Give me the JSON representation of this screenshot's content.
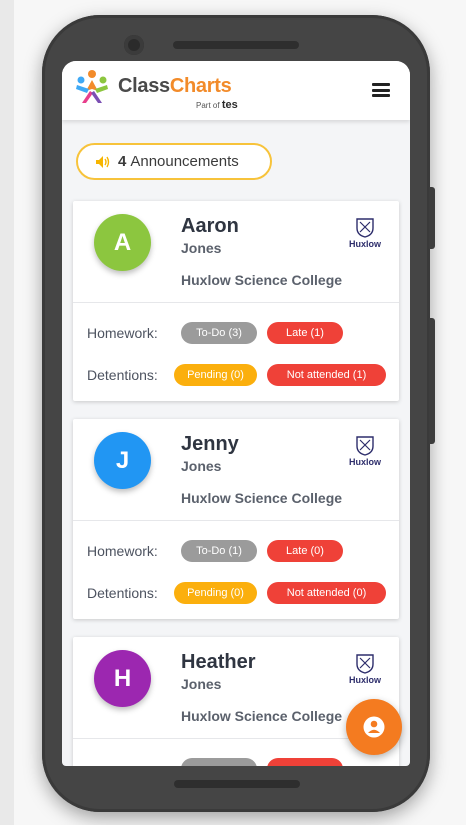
{
  "brand": {
    "name_part1": "Class",
    "name_part2": "Charts",
    "part_of": "Part of",
    "part_of_brand": "tes"
  },
  "announcements": {
    "count": "4",
    "label": "Announcements"
  },
  "labels": {
    "homework": "Homework:",
    "detentions": "Detentions:"
  },
  "students": [
    {
      "initial": "A",
      "first_name": "Aaron",
      "last_name": "Jones",
      "school": "Huxlow Science College",
      "school_logo_text": "Huxlow",
      "avatar_color": "#8cc63f",
      "homework": {
        "todo": "To-Do (3)",
        "late": "Late (1)"
      },
      "detentions": {
        "pending": "Pending (0)",
        "not_attended": "Not attended (1)"
      }
    },
    {
      "initial": "J",
      "first_name": "Jenny",
      "last_name": "Jones",
      "school": "Huxlow Science College",
      "school_logo_text": "Huxlow",
      "avatar_color": "#2196f3",
      "homework": {
        "todo": "To-Do (1)",
        "late": "Late (0)"
      },
      "detentions": {
        "pending": "Pending (0)",
        "not_attended": "Not attended (0)"
      }
    },
    {
      "initial": "H",
      "first_name": "Heather",
      "last_name": "Jones",
      "school": "Huxlow Science College",
      "school_logo_text": "Huxlow",
      "avatar_color": "#9c27b0",
      "homework": {
        "todo": "",
        "late": ""
      },
      "detentions": {
        "pending": "",
        "not_attended": ""
      }
    }
  ],
  "colors": {
    "accent": "#f47b20",
    "announce_border": "#f7c33b",
    "red": "#ef4138",
    "amber": "#fbaf0d",
    "grey": "#9b9b9b"
  },
  "icons": {
    "menu": "hamburger-menu-icon",
    "announce": "speaker-icon",
    "fab": "user-icon"
  }
}
